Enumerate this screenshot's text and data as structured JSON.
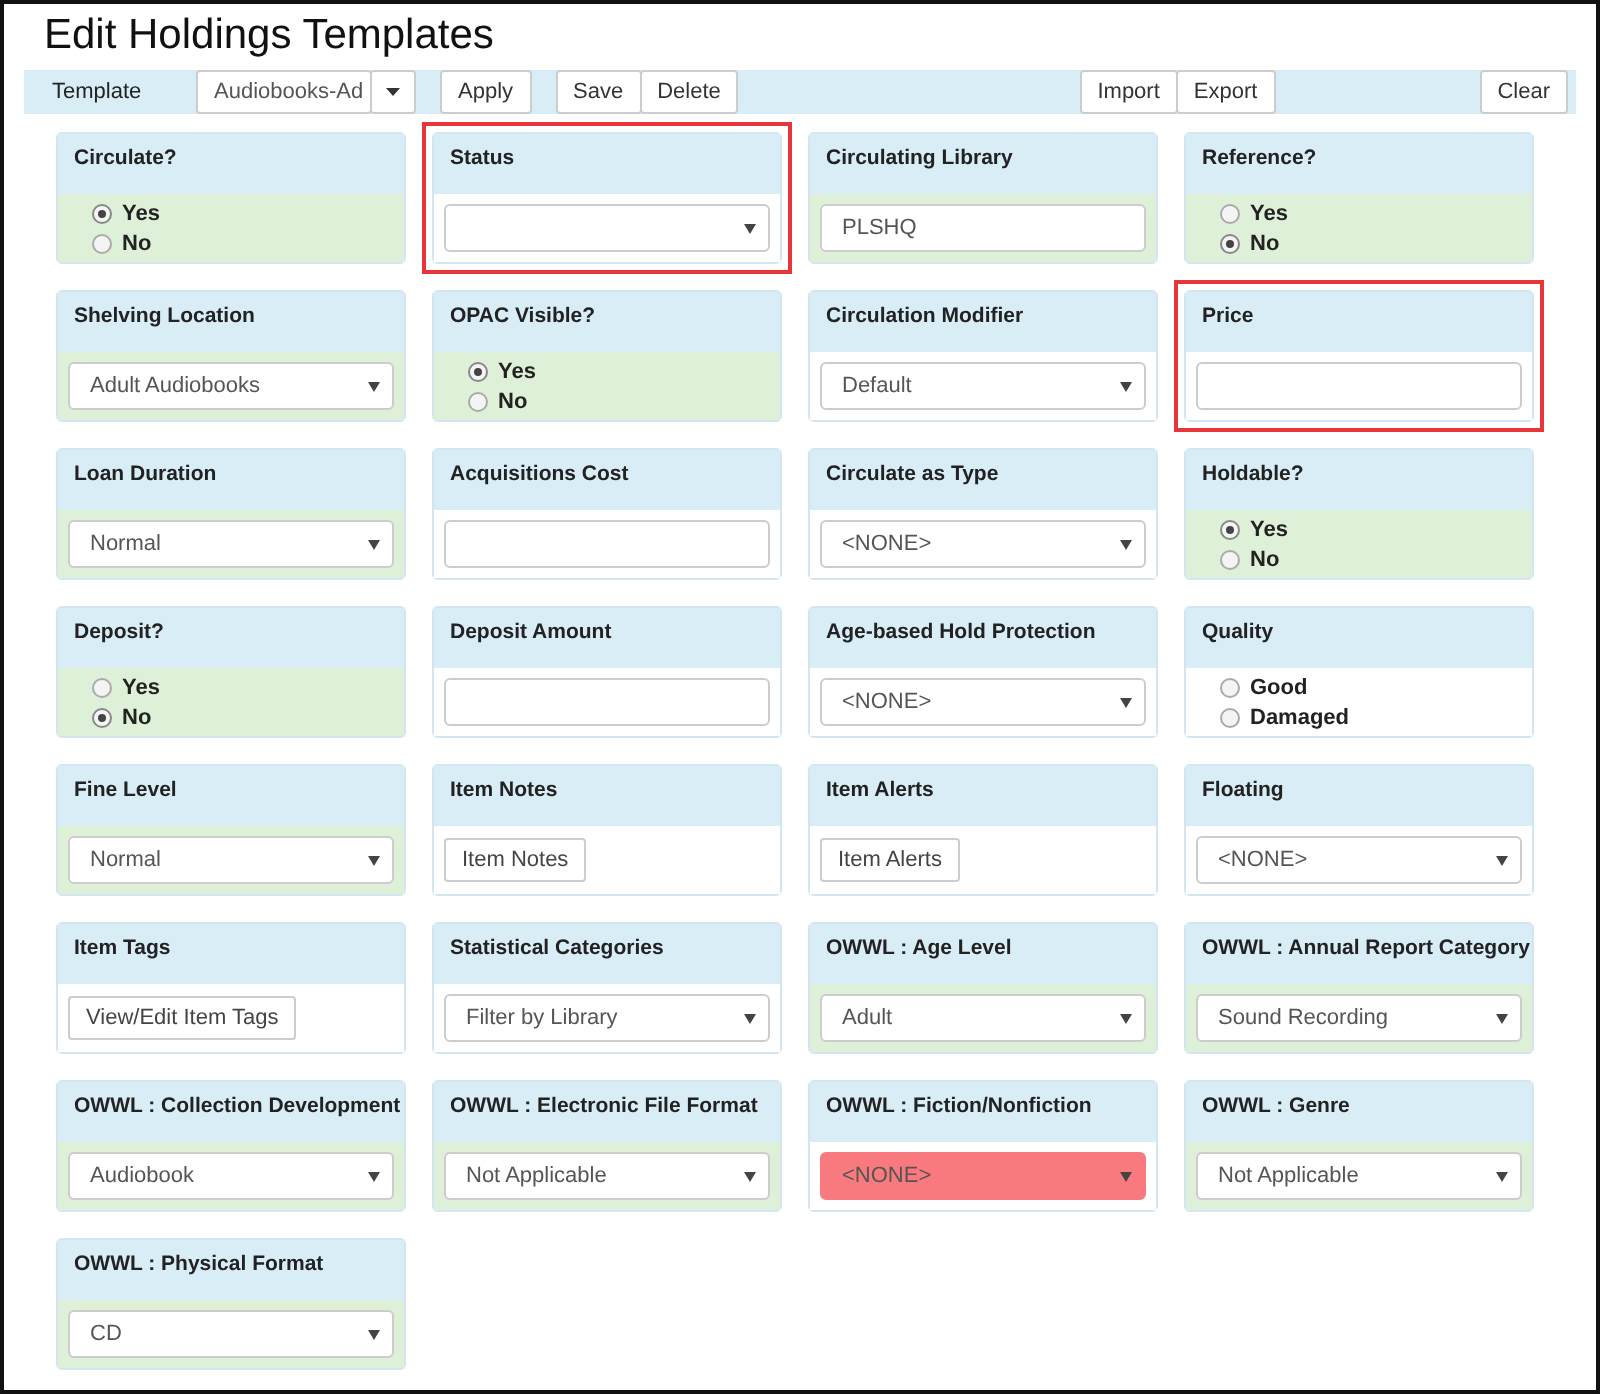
{
  "title": "Edit Holdings Templates",
  "toolbar": {
    "label": "Template",
    "template": "Audiobooks-Ad",
    "groups": [
      {
        "pushed_right": false,
        "buttons": [
          "Apply"
        ]
      },
      {
        "pushed_right": false,
        "buttons": [
          "Save",
          "Delete"
        ]
      },
      {
        "pushed_right": true,
        "buttons": [
          "Import",
          "Export"
        ]
      },
      {
        "pushed_right": false,
        "buttons": [
          "Clear"
        ]
      }
    ]
  },
  "fields": [
    {
      "label": "Circulate?",
      "kind": "radio",
      "set": true,
      "highlighted": false,
      "options": [
        {
          "label": "Yes",
          "selected": true
        },
        {
          "label": "No",
          "selected": false
        }
      ]
    },
    {
      "label": "Status",
      "kind": "select",
      "set": false,
      "highlighted": true
    },
    {
      "label": "Circulating Library",
      "kind": "text",
      "set": true,
      "highlighted": false,
      "value": "PLSHQ"
    },
    {
      "label": "Reference?",
      "kind": "radio",
      "set": true,
      "highlighted": false,
      "options": [
        {
          "label": "Yes",
          "selected": false
        },
        {
          "label": "No",
          "selected": true
        }
      ]
    },
    {
      "label": "Shelving Location",
      "kind": "select",
      "set": true,
      "highlighted": false,
      "value": "Adult Audiobooks"
    },
    {
      "label": "OPAC Visible?",
      "kind": "radio",
      "set": true,
      "highlighted": false,
      "options": [
        {
          "label": "Yes",
          "selected": true
        },
        {
          "label": "No",
          "selected": false
        }
      ]
    },
    {
      "label": "Circulation Modifier",
      "kind": "select",
      "set": false,
      "highlighted": false,
      "value": "Default"
    },
    {
      "label": "Price",
      "kind": "text",
      "set": false,
      "highlighted": true
    },
    {
      "label": "Loan Duration",
      "kind": "select",
      "set": true,
      "highlighted": false,
      "value": "Normal"
    },
    {
      "label": "Acquisitions Cost",
      "kind": "text",
      "set": false,
      "highlighted": false
    },
    {
      "label": "Circulate as Type",
      "kind": "select",
      "set": false,
      "highlighted": false,
      "value": "<NONE>"
    },
    {
      "label": "Holdable?",
      "kind": "radio",
      "set": true,
      "highlighted": false,
      "options": [
        {
          "label": "Yes",
          "selected": true
        },
        {
          "label": "No",
          "selected": false
        }
      ]
    },
    {
      "label": "Deposit?",
      "kind": "radio",
      "set": true,
      "highlighted": false,
      "options": [
        {
          "label": "Yes",
          "selected": false
        },
        {
          "label": "No",
          "selected": true
        }
      ]
    },
    {
      "label": "Deposit Amount",
      "kind": "text",
      "set": false,
      "highlighted": false
    },
    {
      "label": "Age-based Hold Protection",
      "kind": "select",
      "set": false,
      "highlighted": false,
      "value": "<NONE>"
    },
    {
      "label": "Quality",
      "kind": "radio",
      "set": false,
      "highlighted": false,
      "options": [
        {
          "label": "Good",
          "selected": false
        },
        {
          "label": "Damaged",
          "selected": false
        }
      ]
    },
    {
      "label": "Fine Level",
      "kind": "select",
      "set": true,
      "highlighted": false,
      "value": "Normal"
    },
    {
      "label": "Item Notes",
      "kind": "button",
      "set": false,
      "highlighted": false,
      "value": "Item Notes"
    },
    {
      "label": "Item Alerts",
      "kind": "button",
      "set": false,
      "highlighted": false,
      "value": "Item Alerts"
    },
    {
      "label": "Floating",
      "kind": "select",
      "set": false,
      "highlighted": false,
      "value": "<NONE>"
    },
    {
      "label": "Item Tags",
      "kind": "button",
      "set": false,
      "highlighted": false,
      "value": "View/Edit Item Tags"
    },
    {
      "label": "Statistical Categories",
      "kind": "select",
      "set": false,
      "highlighted": false,
      "value": "Filter by Library"
    },
    {
      "label": "OWWL : Age Level",
      "kind": "select",
      "set": true,
      "highlighted": false,
      "value": "Adult"
    },
    {
      "label": "OWWL : Annual Report Category",
      "kind": "select",
      "set": true,
      "highlighted": false,
      "value": "Sound Recording"
    },
    {
      "label": "OWWL : Collection Development",
      "kind": "select",
      "set": true,
      "highlighted": false,
      "value": "Audiobook"
    },
    {
      "label": "OWWL : Electronic File Format",
      "kind": "select",
      "set": true,
      "highlighted": false,
      "value": "Not Applicable"
    },
    {
      "label": "OWWL : Fiction/Nonfiction",
      "kind": "select",
      "set": false,
      "highlighted": false,
      "invalid": true,
      "value": "<NONE>"
    },
    {
      "label": "OWWL : Genre",
      "kind": "select",
      "set": true,
      "highlighted": false,
      "value": "Not Applicable"
    },
    {
      "label": "OWWL : Physical Format",
      "kind": "select",
      "set": true,
      "highlighted": false,
      "value": "CD"
    }
  ]
}
